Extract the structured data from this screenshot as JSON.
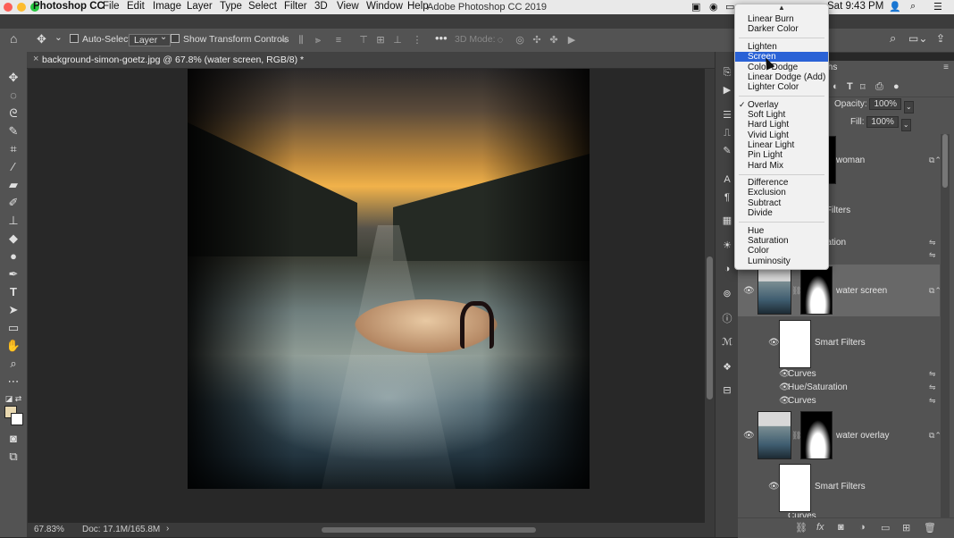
{
  "menubar": {
    "app_name": "Photoshop CC",
    "items": [
      "File",
      "Edit",
      "Image",
      "Layer",
      "Type",
      "Select",
      "Filter",
      "3D",
      "View",
      "Window",
      "Help"
    ],
    "window_title": "Adobe Photoshop CC 2019",
    "clock": "Sat 9:43 PM"
  },
  "options": {
    "auto_select_label": "Auto-Select:",
    "auto_select_value": "Layer",
    "show_transform_label": "Show Transform Controls",
    "mode_3d_label": "3D Mode:"
  },
  "document": {
    "tab_title": "background-simon-goetz.jpg @ 67.8% (water screen, RGB/8) *",
    "close_glyph": "×"
  },
  "status": {
    "zoom": "67.83%",
    "doc_size": "Doc: 17.1M/165.8M",
    "arrow": "›"
  },
  "layers_panel": {
    "tab_partial": "ths",
    "opacity_label": "Opacity:",
    "opacity_value": "100%",
    "fill_label": "Fill:",
    "fill_value": "100%",
    "rows": {
      "woman": "woman",
      "smart_filters_1": "rt Filters",
      "hue_sat_partial": "ration",
      "water_screen": "water screen",
      "smart_filters_2": "Smart Filters",
      "curves_1": "Curves",
      "hue_sat": "Hue/Saturation",
      "curves_2": "Curves",
      "water_overlay": "water overlay",
      "smart_filters_3": "Smart Filters",
      "curves_partial": "Curves"
    }
  },
  "blend_menu": {
    "items": [
      {
        "label": "Linear Burn"
      },
      {
        "label": "Darker Color"
      },
      {
        "label": "Lighten"
      },
      {
        "label": "Screen"
      },
      {
        "label": "Color Dodge"
      },
      {
        "label": "Linear Dodge (Add)"
      },
      {
        "label": "Lighter Color"
      },
      {
        "label": "Overlay"
      },
      {
        "label": "Soft Light"
      },
      {
        "label": "Hard Light"
      },
      {
        "label": "Vivid Light"
      },
      {
        "label": "Linear Light"
      },
      {
        "label": "Pin Light"
      },
      {
        "label": "Hard Mix"
      },
      {
        "label": "Difference"
      },
      {
        "label": "Exclusion"
      },
      {
        "label": "Subtract"
      },
      {
        "label": "Divide"
      },
      {
        "label": "Hue"
      },
      {
        "label": "Saturation"
      },
      {
        "label": "Color"
      },
      {
        "label": "Luminosity"
      }
    ],
    "highlighted": "Screen",
    "checked": "Overlay",
    "check_glyph": "✓"
  },
  "icons": {
    "home": "⌂",
    "move": "✥",
    "search": "⌕",
    "fx": "fx",
    "trash": "🗑"
  },
  "colors": {
    "highlight": "#2a62d6",
    "panel": "#535353",
    "foreground_swatch": "#e8d8b0",
    "background_swatch": "#ffffff"
  }
}
